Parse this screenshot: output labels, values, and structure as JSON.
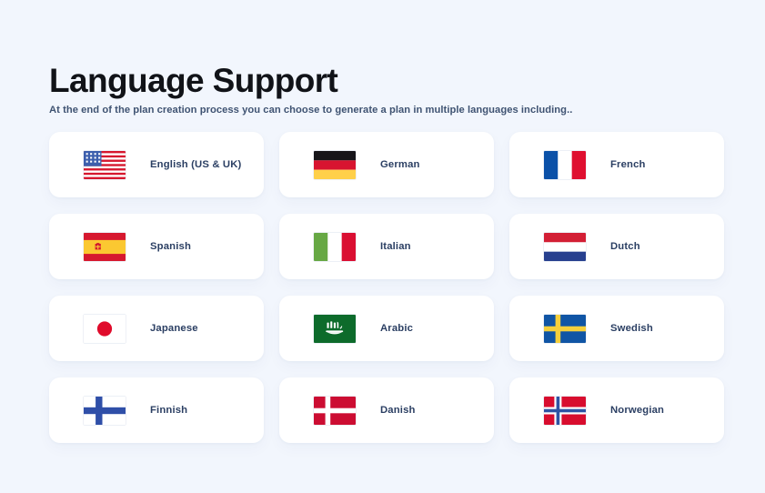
{
  "header": {
    "title": "Language Support",
    "subtitle": "At the end of the plan creation process you can choose to generate a plan in multiple languages including.."
  },
  "colors": {
    "page_background": "#f2f6fd",
    "card_background": "#ffffff",
    "title_text": "#111318",
    "subtitle_text": "#3f5372",
    "label_text": "#2b3f63"
  },
  "languages": [
    {
      "label": "English (US & UK)",
      "flag": "flag-united-states-icon"
    },
    {
      "label": "German",
      "flag": "flag-germany-icon"
    },
    {
      "label": "French",
      "flag": "flag-france-icon"
    },
    {
      "label": "Spanish",
      "flag": "flag-spain-icon"
    },
    {
      "label": "Italian",
      "flag": "flag-italy-icon"
    },
    {
      "label": "Dutch",
      "flag": "flag-netherlands-icon"
    },
    {
      "label": "Japanese",
      "flag": "flag-japan-icon"
    },
    {
      "label": "Arabic",
      "flag": "flag-saudi-arabia-icon"
    },
    {
      "label": "Swedish",
      "flag": "flag-sweden-icon"
    },
    {
      "label": "Finnish",
      "flag": "flag-finland-icon"
    },
    {
      "label": "Danish",
      "flag": "flag-denmark-icon"
    },
    {
      "label": "Norwegian",
      "flag": "flag-norway-icon"
    }
  ]
}
